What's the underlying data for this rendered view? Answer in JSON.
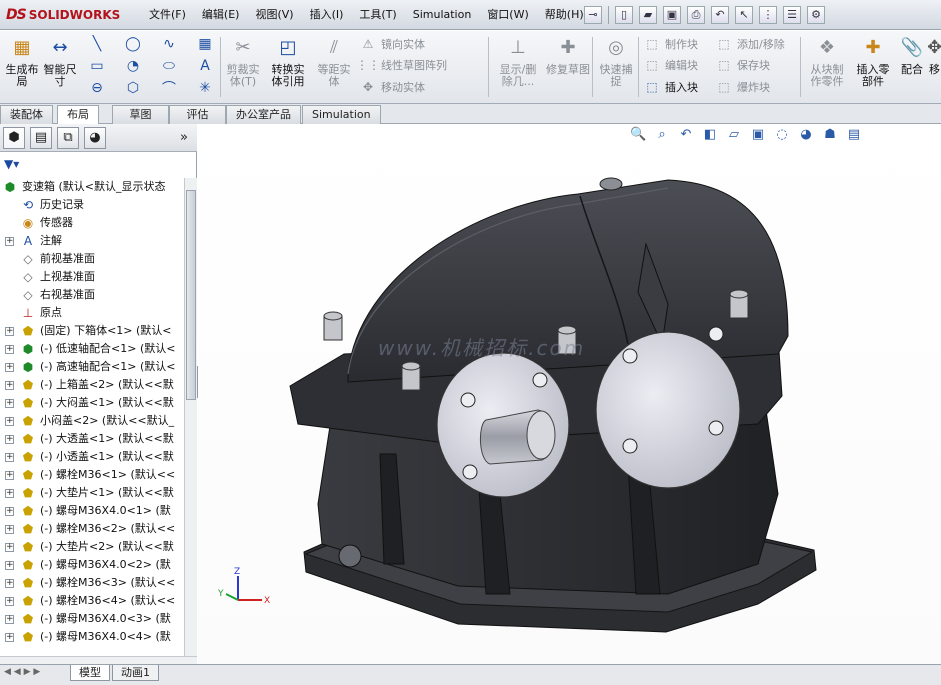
{
  "app": {
    "brand_mark": "DS",
    "brand_name": "SOLIDWORKS"
  },
  "menu": [
    "文件(F)",
    "编辑(E)",
    "视图(V)",
    "插入(I)",
    "工具(T)",
    "Simulation",
    "窗口(W)",
    "帮助(H)"
  ],
  "ribbon": {
    "generate_layout": "生成布局",
    "smart_dim": "智能尺寸",
    "trim_entities": "剪裁实体(T)",
    "convert_entities": "转换实体引用",
    "offset_entities": "等距实体",
    "mirror_entities": "镜向实体",
    "linear_pattern": "线性草图阵列",
    "move_entities": "移动实体",
    "show_delete_relations": "显示/删除几...",
    "repair_sketch": "修复草图",
    "quick_snap": "快速捕捉",
    "make_block": "制作块",
    "edit_block": "编辑块",
    "insert_block": "插入块",
    "add_remove": "添加/移除",
    "save_block": "保存块",
    "explode_block": "爆炸块",
    "make_part_from_block": "从块制作零件",
    "insert_part": "插入零部件",
    "mate": "配合",
    "more": "移"
  },
  "tabs": [
    "装配体",
    "布局",
    "草图",
    "评估",
    "办公室产品",
    "Simulation"
  ],
  "active_tab": "布局",
  "tree": {
    "expand_arrow": "»",
    "filter": "▼▾",
    "root": "变速箱 (默认<默认_显示状态",
    "items": [
      {
        "label": "历史记录",
        "icon": "history-icon",
        "expand": false
      },
      {
        "label": "传感器",
        "icon": "sensor-icon",
        "expand": false
      },
      {
        "label": "注解",
        "icon": "annotation-icon",
        "expand": true
      },
      {
        "label": "前视基准面",
        "icon": "plane-icon",
        "expand": false
      },
      {
        "label": "上视基准面",
        "icon": "plane-icon",
        "expand": false
      },
      {
        "label": "右视基准面",
        "icon": "plane-icon",
        "expand": false
      },
      {
        "label": "原点",
        "icon": "origin-icon",
        "expand": false
      },
      {
        "label": "(固定) 下箱体<1> (默认<",
        "icon": "part-icon",
        "expand": true
      },
      {
        "label": "(-) 低速轴配合<1> (默认<",
        "icon": "subassembly-icon",
        "expand": true
      },
      {
        "label": "(-) 高速轴配合<1> (默认<",
        "icon": "subassembly-icon",
        "expand": true
      },
      {
        "label": "(-) 上箱盖<2> (默认<<默",
        "icon": "part-icon",
        "expand": true
      },
      {
        "label": "(-) 大闷盖<1> (默认<<默",
        "icon": "part-icon",
        "expand": true
      },
      {
        "label": "小闷盖<2> (默认<<默认_",
        "icon": "part-icon",
        "expand": true
      },
      {
        "label": "(-) 大透盖<1> (默认<<默",
        "icon": "part-icon",
        "expand": true
      },
      {
        "label": "(-) 小透盖<1> (默认<<默",
        "icon": "part-icon",
        "expand": true
      },
      {
        "label": "(-) 螺栓M36<1> (默认<<",
        "icon": "part-icon",
        "expand": true
      },
      {
        "label": "(-) 大垫片<1> (默认<<默",
        "icon": "part-icon",
        "expand": true
      },
      {
        "label": "(-) 螺母M36X4.0<1> (默",
        "icon": "part-icon",
        "expand": true
      },
      {
        "label": "(-) 螺栓M36<2> (默认<<",
        "icon": "part-icon",
        "expand": true
      },
      {
        "label": "(-) 大垫片<2> (默认<<默",
        "icon": "part-icon",
        "expand": true
      },
      {
        "label": "(-) 螺母M36X4.0<2> (默",
        "icon": "part-icon",
        "expand": true
      },
      {
        "label": "(-) 螺栓M36<3> (默认<<",
        "icon": "part-icon",
        "expand": true
      },
      {
        "label": "(-) 螺栓M36<4> (默认<<",
        "icon": "part-icon",
        "expand": true
      },
      {
        "label": "(-) 螺母M36X4.0<3> (默",
        "icon": "part-icon",
        "expand": true
      },
      {
        "label": "(-) 螺母M36X4.0<4> (默",
        "icon": "part-icon",
        "expand": true
      }
    ]
  },
  "bottom_tabs": [
    "模型",
    "动画1"
  ],
  "watermark": "www.机械招标.com",
  "colors": {
    "housing": "#2e2f33",
    "cover": "#d9dae2",
    "brand": "#b3121b"
  }
}
